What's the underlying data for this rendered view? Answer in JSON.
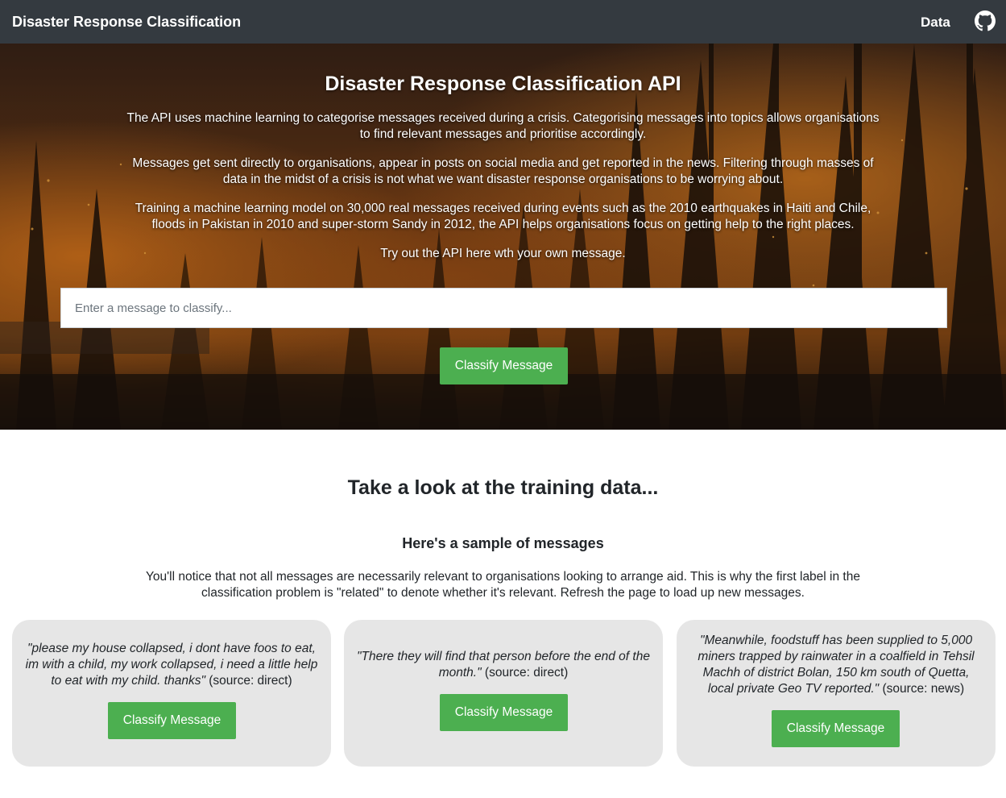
{
  "navbar": {
    "brand": "Disaster Response Classification",
    "data_link": "Data",
    "github_icon": "github-icon"
  },
  "hero": {
    "title": "Disaster Response Classification API",
    "paragraphs": [
      "The API uses machine learning to categorise messages received during a crisis. Categorising messages into topics allows organisations to find relevant messages and prioritise accordingly.",
      "Messages get sent directly to organisations, appear in posts on social media and get reported in the news. Filtering through masses of data in the midst of a crisis is not what we want disaster response organisations to be worrying about.",
      "Training a machine learning model on 30,000 real messages received during events such as the 2010 earthquakes in Haiti and Chile, floods in Pakistan in 2010 and super-storm Sandy in 2012, the API helps organisations focus on getting help to the right places.",
      "Try out the API here wth your own message."
    ],
    "input_placeholder": "Enter a message to classify...",
    "input_value": "",
    "classify_button": "Classify Message"
  },
  "training": {
    "title": "Take a look at the training data...",
    "subtitle": "Here's a sample of messages",
    "description": "You'll notice that not all messages are necessarily relevant to organisations looking to arrange aid. This is why the first label in the classification problem is \"related\" to denote whether it's relevant. Refresh the page to load up new messages.",
    "samples": [
      {
        "message": "\"please my house collapsed, i dont have foos to eat, im with a child, my work collapsed, i need a little help to eat with my child. thanks\"",
        "source": " (source: direct)",
        "button": "Classify Message"
      },
      {
        "message": "\"There they will find that person before the end of the month.\"",
        "source": " (source: direct)",
        "button": "Classify Message"
      },
      {
        "message": "\"Meanwhile, foodstuff has been supplied to 5,000 miners trapped by rainwater in a coalfield in Tehsil Machh of district Bolan, 150 km south of Quetta, local private Geo TV reported.\"",
        "source": " (source: news)",
        "button": "Classify Message"
      }
    ]
  },
  "colors": {
    "navbar_bg": "#343a40",
    "button_green": "#4caf50",
    "card_bg": "#e6e6e6"
  }
}
